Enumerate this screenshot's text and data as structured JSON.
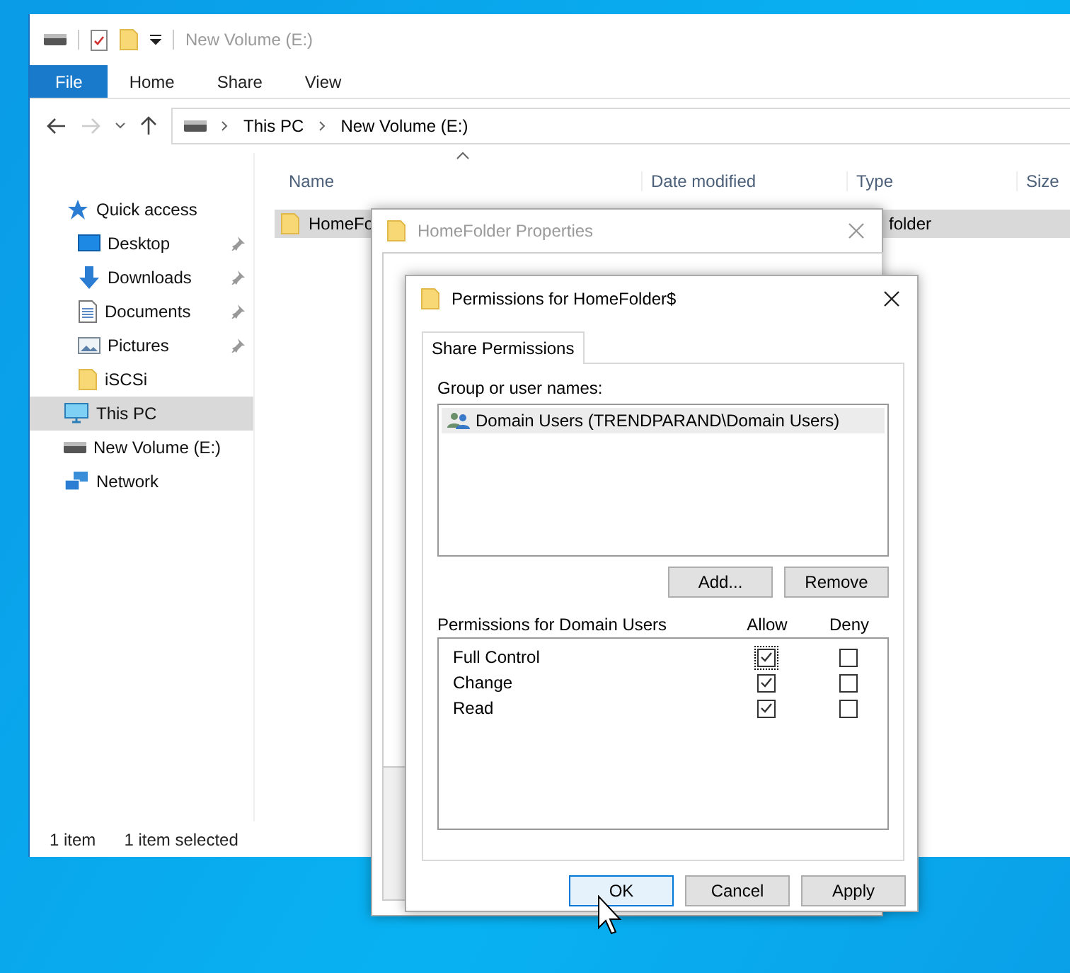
{
  "explorer": {
    "title": "New Volume (E:)",
    "ribbon_tabs": [
      {
        "label": "File",
        "selected": true
      },
      {
        "label": "Home",
        "selected": false
      },
      {
        "label": "Share",
        "selected": false
      },
      {
        "label": "View",
        "selected": false
      }
    ],
    "breadcrumb": [
      "This PC",
      "New Volume (E:)"
    ],
    "sidebar": {
      "items": [
        {
          "label": "Quick access",
          "kind": "star",
          "selected": false,
          "children": [
            {
              "label": "Desktop",
              "kind": "desktop",
              "pinned": true,
              "selected": false
            },
            {
              "label": "Downloads",
              "kind": "download",
              "pinned": true,
              "selected": false
            },
            {
              "label": "Documents",
              "kind": "document",
              "pinned": true,
              "selected": false
            },
            {
              "label": "Pictures",
              "kind": "pictures",
              "pinned": true,
              "selected": false
            },
            {
              "label": "iSCSi",
              "kind": "folder",
              "pinned": false,
              "selected": false
            }
          ]
        },
        {
          "label": "This PC",
          "kind": "pc",
          "selected": true
        },
        {
          "label": "New Volume (E:)",
          "kind": "drive",
          "selected": false
        },
        {
          "label": "Network",
          "kind": "network",
          "selected": false
        }
      ]
    },
    "columns": [
      "Name",
      "Date modified",
      "Type",
      "Size"
    ],
    "rows": [
      {
        "name": "HomeFo",
        "type": "folder",
        "selected": true
      }
    ],
    "status_bar": [
      "1 item",
      "1 item selected"
    ]
  },
  "properties_dialog": {
    "title": "HomeFolder Properties"
  },
  "permissions_dialog": {
    "title": "Permissions for HomeFolder$",
    "tabs": [
      {
        "label": "Share Permissions",
        "selected": true
      }
    ],
    "group_label": "Group or user names:",
    "users": [
      {
        "name": "Domain Users (TRENDPARAND\\Domain Users)",
        "selected": true
      }
    ],
    "user_buttons": [
      "Add...",
      "Remove"
    ],
    "permissions_label": "Permissions for Domain Users",
    "permission_columns": [
      "Allow",
      "Deny"
    ],
    "permissions": [
      {
        "name": "Full Control",
        "allow": true,
        "deny": false,
        "focused": true
      },
      {
        "name": "Change",
        "allow": true,
        "deny": false,
        "focused": false
      },
      {
        "name": "Read",
        "allow": true,
        "deny": false,
        "focused": false
      }
    ],
    "buttons": [
      {
        "label": "OK",
        "default": true
      },
      {
        "label": "Cancel",
        "default": false
      },
      {
        "label": "Apply",
        "default": false
      }
    ]
  }
}
